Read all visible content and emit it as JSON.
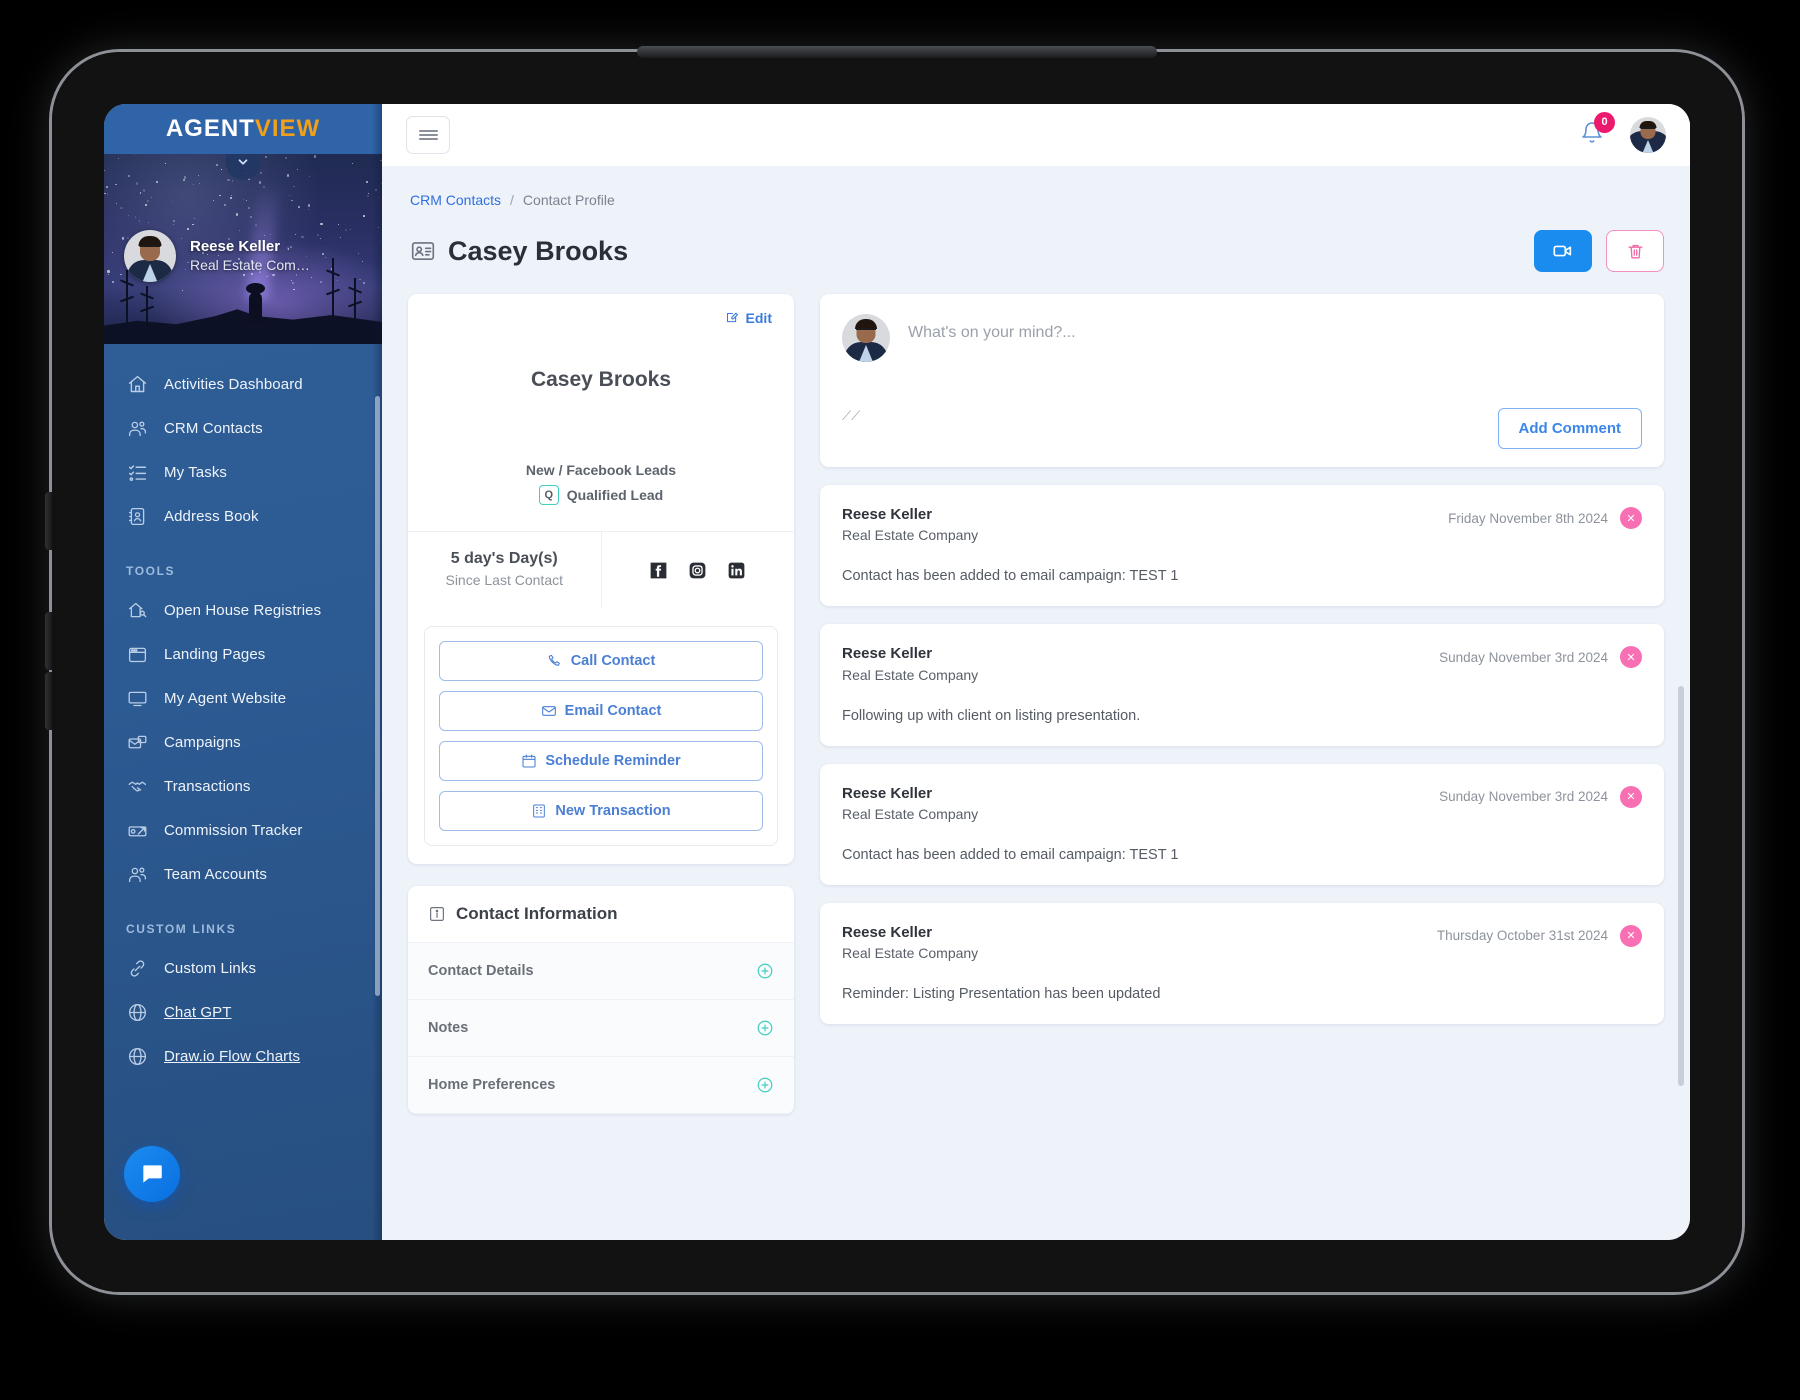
{
  "brand": {
    "part1": "AGENT",
    "part2": "VIEW"
  },
  "sidebar": {
    "profile": {
      "name": "Reese Keller",
      "company": "Real Estate Com…"
    },
    "items": [
      {
        "label": "Activities Dashboard",
        "icon": "home-icon"
      },
      {
        "label": "CRM Contacts",
        "icon": "contacts-icon"
      },
      {
        "label": "My Tasks",
        "icon": "tasks-icon"
      },
      {
        "label": "Address Book",
        "icon": "address-book-icon"
      }
    ],
    "tools_section": "TOOLS",
    "tools": [
      {
        "label": "Open House Registries",
        "icon": "open-house-icon"
      },
      {
        "label": "Landing Pages",
        "icon": "landing-page-icon"
      },
      {
        "label": "My Agent Website",
        "icon": "monitor-icon"
      },
      {
        "label": "Campaigns",
        "icon": "campaign-icon"
      },
      {
        "label": "Transactions",
        "icon": "handshake-icon"
      },
      {
        "label": "Commission Tracker",
        "icon": "money-icon"
      },
      {
        "label": "Team Accounts",
        "icon": "team-icon"
      }
    ],
    "custom_section": "CUSTOM LINKS",
    "custom_links": [
      {
        "label": "Custom Links",
        "icon": "link-icon"
      },
      {
        "label": "Chat GPT",
        "icon": "globe-icon"
      },
      {
        "label": "Draw.io Flow Charts",
        "icon": "globe-icon"
      }
    ]
  },
  "topbar": {
    "notification_count": "0"
  },
  "breadcrumb": {
    "link": "CRM Contacts",
    "separator": "/",
    "current": "Contact Profile"
  },
  "page": {
    "title": "Casey Brooks"
  },
  "contact_card": {
    "edit_label": "Edit",
    "name": "Casey Brooks",
    "source": "New / Facebook Leads",
    "lead_badge": "Q",
    "lead_status": "Qualified Lead",
    "days_value": "5 day's Day(s)",
    "days_label": "Since Last Contact",
    "socials": [
      "facebook-icon",
      "instagram-icon",
      "linkedin-icon"
    ]
  },
  "actions": [
    {
      "label": "Call Contact",
      "icon": "phone-icon"
    },
    {
      "label": "Email Contact",
      "icon": "envelope-icon"
    },
    {
      "label": "Schedule Reminder",
      "icon": "calendar-icon"
    },
    {
      "label": "New Transaction",
      "icon": "building-icon"
    }
  ],
  "contact_information": {
    "header": "Contact Information",
    "rows": [
      {
        "label": "Contact Details"
      },
      {
        "label": "Notes"
      },
      {
        "label": "Home Preferences"
      }
    ]
  },
  "composer": {
    "placeholder": "What's on your mind?...",
    "value": "",
    "add_comment_label": "Add Comment"
  },
  "feed": [
    {
      "author": "Reese Keller",
      "company": "Real Estate Company",
      "date": "Friday November 8th 2024",
      "body": "Contact has been added to email campaign: TEST 1"
    },
    {
      "author": "Reese Keller",
      "company": "Real Estate Company",
      "date": "Sunday November 3rd 2024",
      "body": "Following up with client on listing presentation."
    },
    {
      "author": "Reese Keller",
      "company": "Real Estate Company",
      "date": "Sunday November 3rd 2024",
      "body": "Contact has been added to email campaign: TEST 1"
    },
    {
      "author": "Reese Keller",
      "company": "Real Estate Company",
      "date": "Thursday October 31st 2024",
      "body": "Reminder: Listing Presentation has been updated"
    }
  ],
  "colors": {
    "sidebar_blue": "#2c5a92",
    "brand_orange": "#f0a019",
    "accent_blue": "#1a8cf0",
    "accent_pink": "#ec1a6e",
    "teal": "#3fd0bf"
  }
}
